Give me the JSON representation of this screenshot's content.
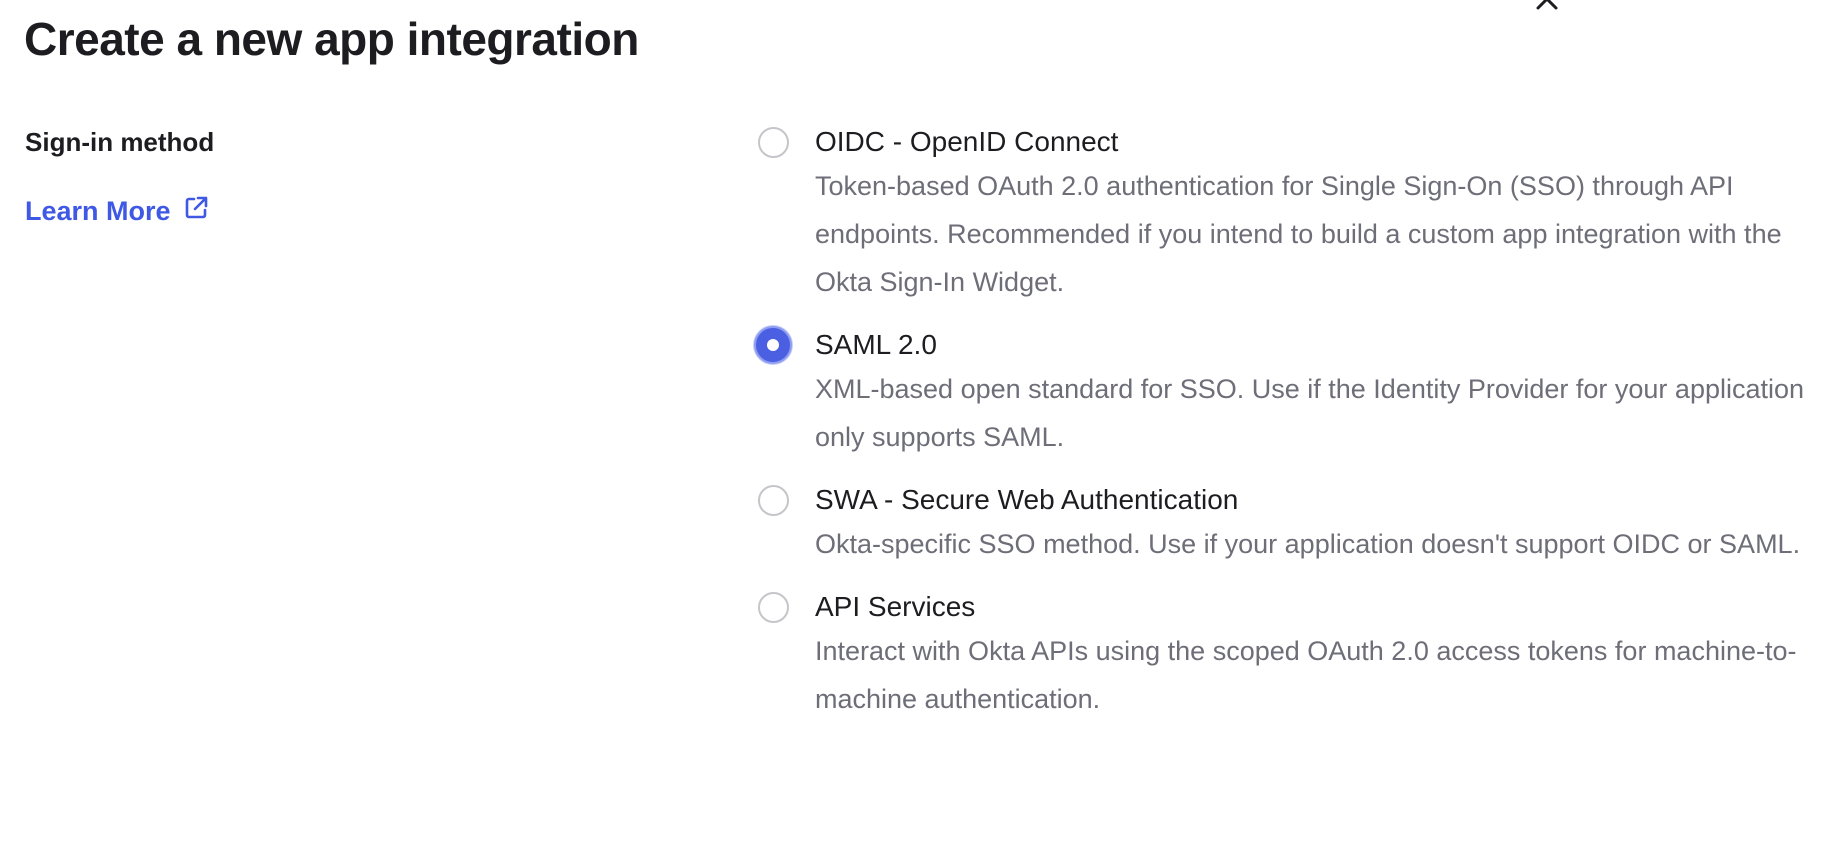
{
  "dialog": {
    "title": "Create a new app integration",
    "close_icon": "close-icon"
  },
  "sign_in": {
    "label": "Sign-in method",
    "learn_more": "Learn More",
    "learn_more_icon": "external-link-icon",
    "options": [
      {
        "title": "OIDC - OpenID Connect",
        "description": "Token-based OAuth 2.0 authentication for Single Sign-On (SSO) through API endpoints. Recommended if you intend to build a custom app integration with the Okta Sign-In Widget.",
        "selected": false
      },
      {
        "title": "SAML 2.0",
        "description": "XML-based open standard for SSO. Use if the Identity Provider for your application only supports SAML.",
        "selected": true
      },
      {
        "title": "SWA - Secure Web Authentication",
        "description": "Okta-specific SSO method. Use if your application doesn't support OIDC or SAML.",
        "selected": false
      },
      {
        "title": "API Services",
        "description": "Interact with Okta APIs using the scoped OAuth 2.0 access tokens for machine-to-machine authentication.",
        "selected": false
      }
    ]
  },
  "colors": {
    "accent": "#3f59e4",
    "radio_selected": "#4b5fe2",
    "text_primary": "#1d1d21",
    "text_secondary": "#6e6e78"
  }
}
